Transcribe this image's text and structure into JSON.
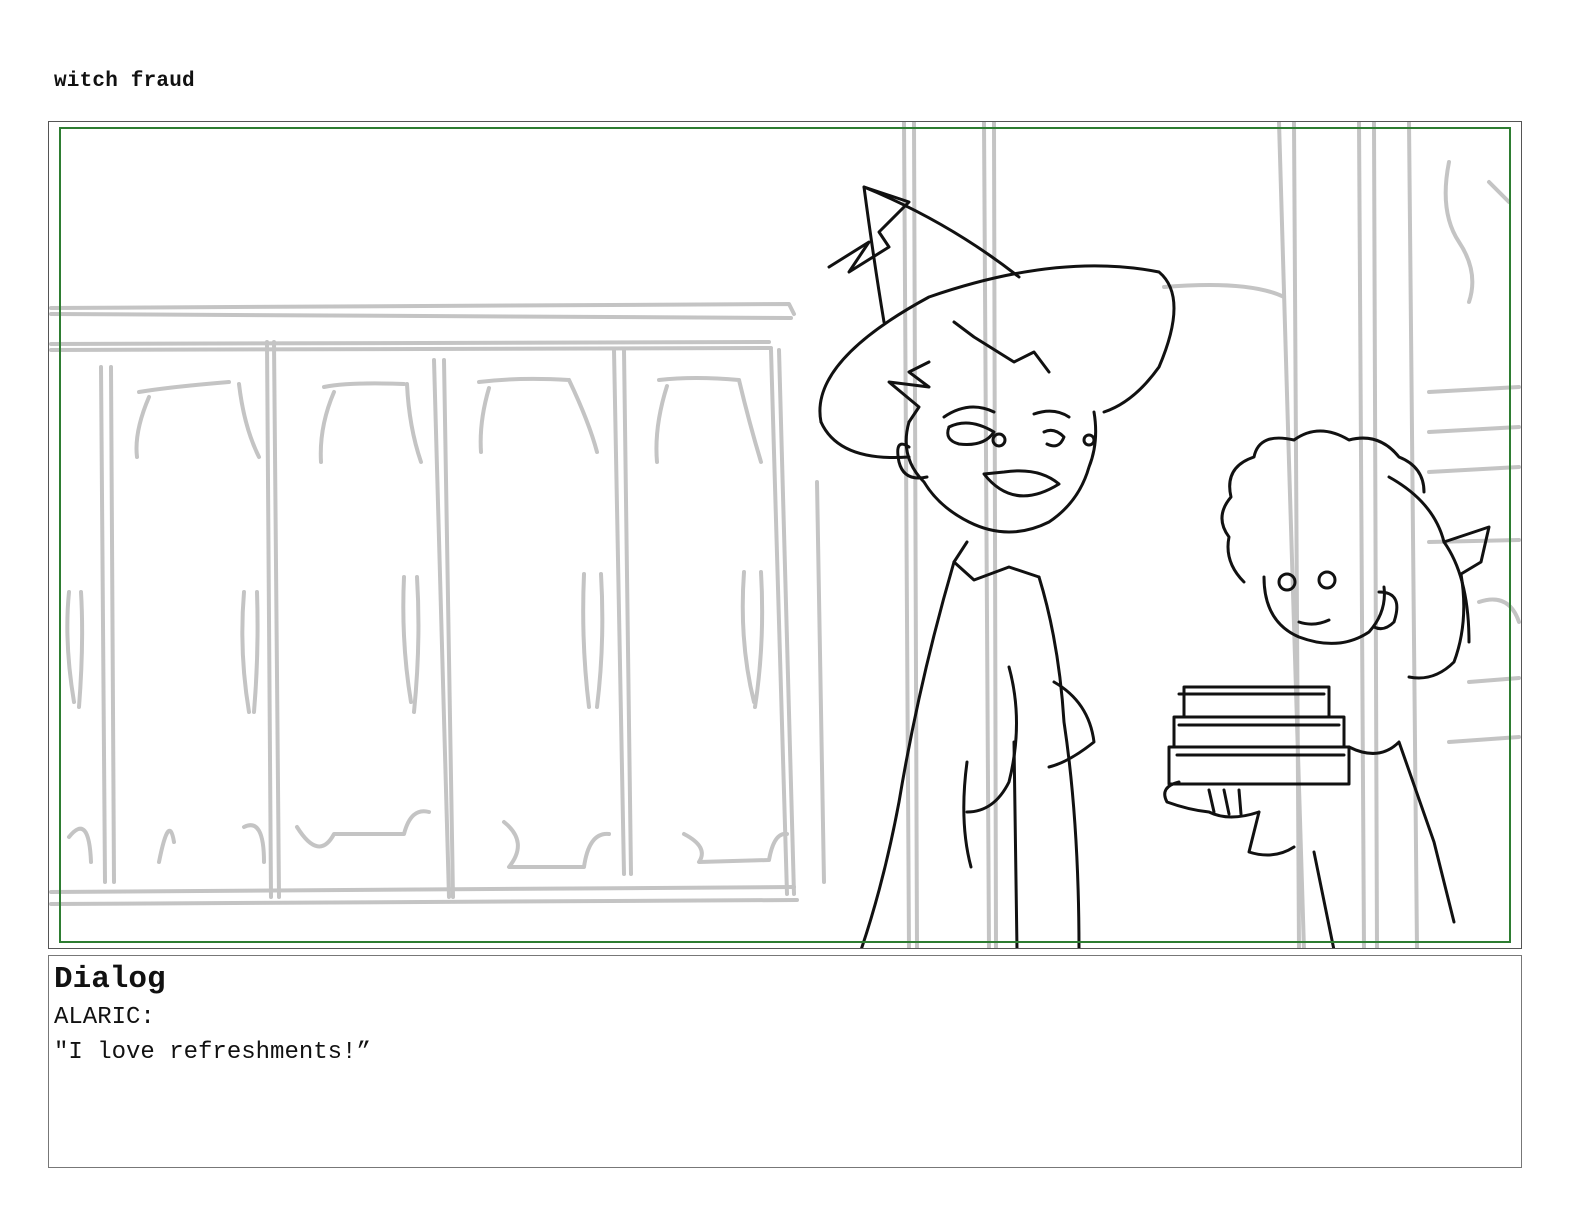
{
  "page": {
    "title": "witch fraud"
  },
  "panel": {
    "description_icon": "storyboard-sketch-icon",
    "colors": {
      "sketch": "#111111",
      "background_sketch": "#c4c4c4",
      "safe_frame": "#2e7d32"
    }
  },
  "dialog": {
    "heading": "Dialog",
    "lines": [
      "ALARIC:",
      "\"I love refreshments!”"
    ]
  }
}
